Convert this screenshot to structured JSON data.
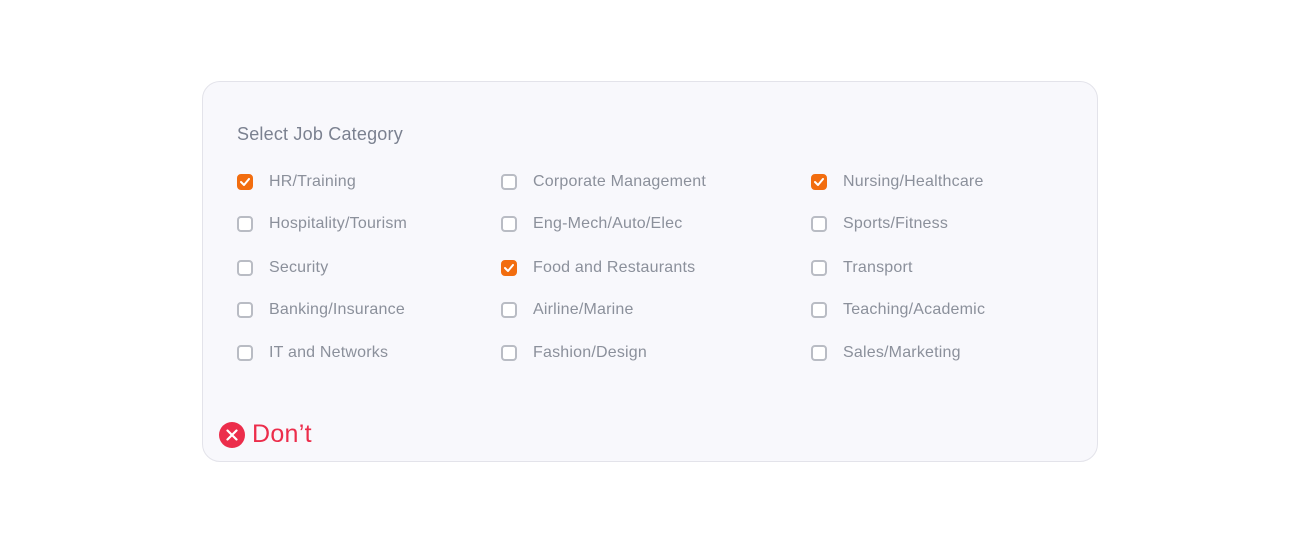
{
  "form": {
    "title": "Select Job Category",
    "options": [
      {
        "label": "HR/Training",
        "checked": true
      },
      {
        "label": "Corporate Management",
        "checked": false
      },
      {
        "label": "Nursing/Healthcare",
        "checked": true
      },
      {
        "label": "Hospitality/Tourism",
        "checked": false
      },
      {
        "label": "Eng-Mech/Auto/Elec",
        "checked": false
      },
      {
        "label": "Sports/Fitness",
        "checked": false
      },
      {
        "label": "Security",
        "checked": false
      },
      {
        "label": "Food and Restaurants",
        "checked": true
      },
      {
        "label": "Transport",
        "checked": false
      },
      {
        "label": "Banking/Insurance",
        "checked": false
      },
      {
        "label": "Airline/Marine",
        "checked": false
      },
      {
        "label": "Teaching/Academic",
        "checked": false
      },
      {
        "label": "IT and Networks",
        "checked": false
      },
      {
        "label": "Fashion/Design",
        "checked": false
      },
      {
        "label": "Sales/Marketing",
        "checked": false
      }
    ]
  },
  "annotation": {
    "label": "Don’t",
    "icon": "close-circle-icon"
  },
  "colors": {
    "accent": "#f26d0f",
    "error": "#ec2d4b",
    "text": "#8b909b",
    "card_background": "#f8f8fc"
  }
}
